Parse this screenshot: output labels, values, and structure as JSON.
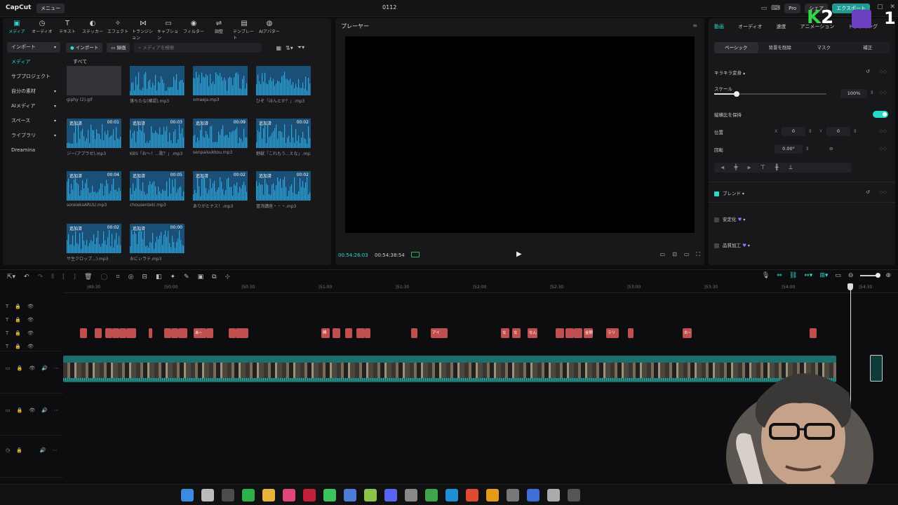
{
  "app": {
    "logo": "CapCut",
    "menu_label": "メニュー",
    "project_title": "0112",
    "top_buttons": [
      "Pro",
      "シェア",
      "エクスポート"
    ]
  },
  "toolbar": {
    "tabs": [
      {
        "label": "メディア",
        "icon": "media-icon"
      },
      {
        "label": "オーディオ",
        "icon": "audio-icon"
      },
      {
        "label": "テキスト",
        "icon": "text-icon"
      },
      {
        "label": "ステッカー",
        "icon": "sticker-icon"
      },
      {
        "label": "エフェクト",
        "icon": "effect-icon"
      },
      {
        "label": "トランジション",
        "icon": "transition-icon"
      },
      {
        "label": "キャプション",
        "icon": "caption-icon"
      },
      {
        "label": "フィルター",
        "icon": "filter-icon"
      },
      {
        "label": "調整",
        "icon": "adjust-icon"
      },
      {
        "label": "テンプレート",
        "icon": "template-icon"
      },
      {
        "label": "AIアバター",
        "icon": "avatar-icon"
      }
    ]
  },
  "sidebar": {
    "items": [
      {
        "label": "インポート",
        "expand": true
      },
      {
        "label": "メディア"
      },
      {
        "label": "サブプロジェクト"
      },
      {
        "label": "自分の素材",
        "expand": true
      },
      {
        "label": "AIメディア",
        "expand": true
      },
      {
        "label": "スペース",
        "expand": true
      },
      {
        "label": "ライブラリ",
        "expand": true
      },
      {
        "label": "Dreamina"
      }
    ]
  },
  "media": {
    "import_label": "インポート",
    "record_label": "録画",
    "search_placeholder": "メディアを検索",
    "filter_all": "すべて",
    "added_tag": "追加済",
    "files": [
      {
        "name": "giphy (2).gif",
        "duration": "",
        "added": false
      },
      {
        "name": "落ちたな(確認).mp3",
        "duration": "",
        "added": false
      },
      {
        "name": "omaeja.mp3",
        "duration": "",
        "added": false
      },
      {
        "name": "ひぞ「ほんとか？」.mp3",
        "duration": "",
        "added": false
      },
      {
        "name": "ジー(アプラゼ).mp3",
        "duration": "00:01",
        "added": true
      },
      {
        "name": "KBS「お～！…歌？」.mp3",
        "duration": "00:03",
        "added": true
      },
      {
        "name": "senpaisukkou.mp3",
        "duration": "00:09",
        "added": true
      },
      {
        "name": "野獣「これもう...えな」.mp3",
        "duration": "00:02",
        "added": true
      },
      {
        "name": "soreieksARUU.mp3",
        "duration": "00:04",
        "added": true
      },
      {
        "name": "chousenteki.mp3",
        "duration": "00:05",
        "added": true
      },
      {
        "name": "ありがとナス！.mp3",
        "duration": "00:02",
        "added": true
      },
      {
        "name": "冒涜講座・・・.mp3",
        "duration": "00:02",
        "added": true
      },
      {
        "name": "サ生クロップ...).mp3",
        "duration": "00:02",
        "added": true
      },
      {
        "name": "おにぃラテ.mp3",
        "duration": "00:00",
        "added": true
      }
    ]
  },
  "player": {
    "title": "プレーヤー",
    "current_time": "00:54:26:03",
    "total_time": "00:54:38:54"
  },
  "inspector": {
    "tabs": [
      "動画",
      "オーディオ",
      "速度",
      "アニメーション",
      "トラッキング"
    ],
    "sub_tabs": [
      "ベーシック",
      "背景を削除",
      "マスク",
      "補正"
    ],
    "section_title": "キラキラ変身",
    "scale_label": "スケール",
    "scale_value": "100%",
    "scale_fraction": 0.2,
    "keep_ratio_label": "縦横比を保持",
    "position_label": "位置",
    "pos_x_label": "X",
    "pos_x": "0",
    "pos_y_label": "Y",
    "pos_y": "0",
    "rotation_label": "回転",
    "rotation": "0.00°",
    "blend_label": "ブレンド",
    "stabilize_label": "安定化",
    "enhance_label": "品質加工"
  },
  "timeline": {
    "ticks": [
      "|49:30",
      "|50:00",
      "|50:30",
      "|51:00",
      "|51:30",
      "|52:00",
      "|52:30",
      "|53:00",
      "|53:30",
      "|54:00",
      "|54:30"
    ],
    "text_clips": [
      {
        "label": ""
      },
      {
        "label": ""
      },
      {
        "label": ""
      },
      {
        "label": ""
      },
      {
        "label": ""
      },
      {
        "label": ""
      },
      {
        "label": ""
      },
      {
        "label": ""
      },
      {
        "label": "あ~"
      },
      {
        "label": ""
      },
      {
        "label": ""
      },
      {
        "label": "興奮"
      },
      {
        "label": ""
      },
      {
        "label": ""
      },
      {
        "label": ""
      },
      {
        "label": "アイ"
      },
      {
        "label": "なん"
      },
      {
        "label": "なん"
      },
      {
        "label": "なん"
      },
      {
        "label": ""
      },
      {
        "label": ""
      },
      {
        "label": "金剛"
      },
      {
        "label": "ラリ"
      },
      {
        "label": ""
      },
      {
        "label": "お~"
      },
      {
        "label": ""
      }
    ]
  },
  "overlay": {
    "k_letter": "K",
    "two": "2",
    "one": "1"
  },
  "colors": {
    "accent": "#2bd9cb",
    "clip_text": "#c0504f",
    "clip_video": "#1b6e6a",
    "audio_thumb": "#1a4f78"
  }
}
